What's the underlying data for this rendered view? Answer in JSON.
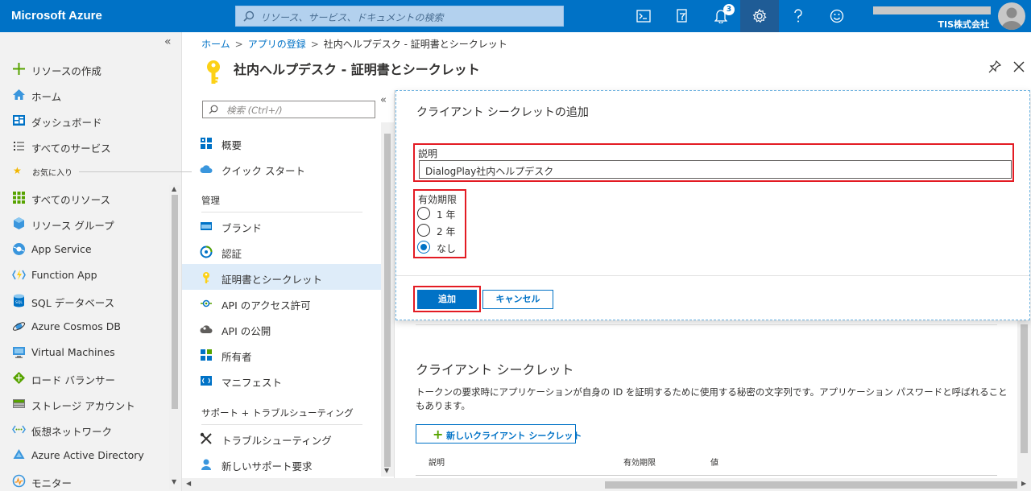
{
  "topbar": {
    "brand": "Microsoft Azure",
    "search_placeholder": "リソース、サービス、ドキュメントの検索",
    "notification_count": "3",
    "company": "TIS株式会社"
  },
  "leftnav": {
    "collapse": "«",
    "create": "リソースの作成",
    "home": "ホーム",
    "dashboard": "ダッシュボード",
    "all_services": "すべてのサービス",
    "favorites": "お気に入り",
    "items": [
      "すべてのリソース",
      "リソース グループ",
      "App Service",
      "Function App",
      "SQL データベース",
      "Azure Cosmos DB",
      "Virtual Machines",
      "ロード バランサー",
      "ストレージ アカウント",
      "仮想ネットワーク",
      "Azure Active Directory",
      "モニター"
    ]
  },
  "breadcrumb": {
    "home": "ホーム",
    "app_reg": "アプリの登録",
    "current": "社内ヘルプデスク - 証明書とシークレット",
    "sep": ">"
  },
  "page": {
    "title": "社内ヘルプデスク - 証明書とシークレット"
  },
  "resmenu": {
    "search_placeholder": "検索 (Ctrl+/)",
    "collapse": "«",
    "overview": "概要",
    "quickstart": "クイック スタート",
    "manage_header": "管理",
    "manage_items": [
      "ブランド",
      "認証",
      "証明書とシークレット",
      "API のアクセス許可",
      "API の公開",
      "所有者",
      "マニフェスト"
    ],
    "support_header": "サポート + トラブルシューティング",
    "support_items": [
      "トラブルシューティング",
      "新しいサポート要求"
    ]
  },
  "dialog": {
    "title": "クライアント シークレットの追加",
    "desc_label": "説明",
    "desc_value": "DialogPlay社内ヘルプデスク",
    "expiry_label": "有効期限",
    "options": [
      "1 年",
      "2 年",
      "なし"
    ],
    "selected_option": "なし",
    "add_label": "追加",
    "cancel_label": "キャンセル"
  },
  "secrets": {
    "section_title": "クライアント シークレット",
    "description": "トークンの要求時にアプリケーションが自身の ID を証明するために使用する秘密の文字列です。アプリケーション パスワードと呼ばれることもあります。",
    "new_button": "新しいクライアント シークレット",
    "columns": [
      "説明",
      "有効期限",
      "値"
    ]
  },
  "colors": {
    "azure_blue": "#0072c6",
    "highlight_red": "#e31b23",
    "selected_bg": "#deecf9"
  }
}
